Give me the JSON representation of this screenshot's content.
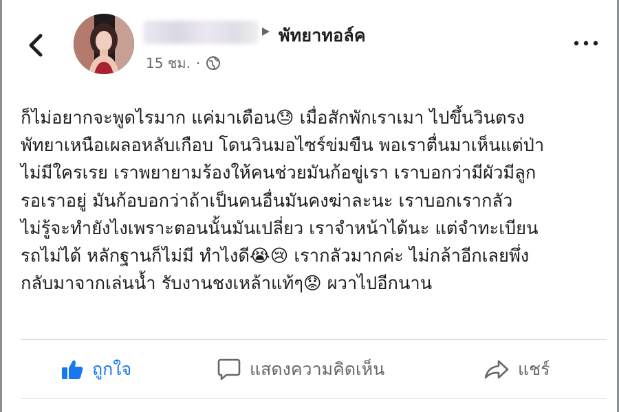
{
  "header": {
    "group_name": "พัทยาทอล์ค",
    "timestamp": "15 ชม.",
    "separator": "·",
    "privacy_icon": "globe-icon",
    "back_icon": "chevron-left-icon",
    "more_icon": "more-dots-icon"
  },
  "post": {
    "lines": [
      "ก็ไม่อยากจะพูดไรมาก แค่มาเตือน😓 เมื่อสักพักเราเมา ไปขึ้นวินตรง",
      "พัทยาเหนือเผลอหลับเกือบ โดนวินมอไซร์ข่มขืน พอเราตื่นมาเห็นแต่ป่า",
      "ไม่มีใครเรย เราพยายามร้องให้คนช่วยมันก้อขู่เรา เราบอกว่ามีผัวมีลูก",
      "รอเราอยู่ มันก้อบอกว่าถ้าเป็นคนอื่นมันคงฆ่าละนะ เราบอกเรากลัว",
      "ไม่รู้จะทำยังไงเพราะตอนนั้นมันเปลี่ยว  เราจำหน้าได้นะ แต่จำทะเบียน",
      "รถไม่ได้ หลักฐานก็ไม่มี ทำไงดี😭😢 เรากลัวมากค่ะ ไม่กล้าอีกเลยพึ่ง",
      "กลับมาจากเล่นน้ำ รับงานชงเหล้าแท้ๆ😟 ผวาไปอีกนาน"
    ]
  },
  "actions": {
    "like_label": "ถูกใจ",
    "comment_label": "แสดงความคิดเห็น",
    "share_label": "แชร์",
    "like_color": "#1877f2"
  }
}
